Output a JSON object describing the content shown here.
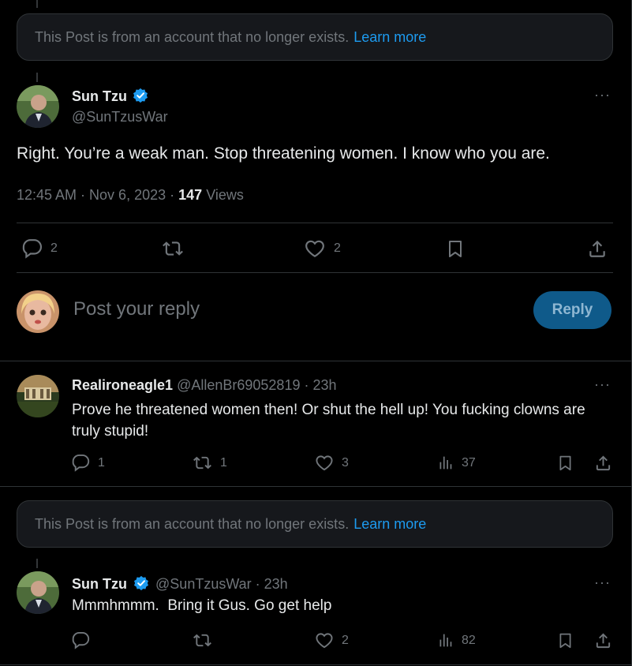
{
  "notice_top": {
    "text": "This Post is from an account that no longer exists.",
    "link": "Learn more"
  },
  "main_post": {
    "name": "Sun Tzu",
    "handle": "@SunTzusWar",
    "text": "Right. You’re a weak man. Stop threatening women. I know who you are.",
    "time": "12:45 AM · Nov 6, 2023 ·",
    "views_count": "147",
    "views_label": "Views",
    "replies": "2",
    "likes": "2"
  },
  "composer": {
    "placeholder": "Post your reply",
    "button": "Reply"
  },
  "reply1": {
    "name": "Realironeagle1",
    "handle": "@AllenBr69052819 · 23h",
    "text": "Prove he threatened women then! Or shut the hell up! You fucking clowns are truly stupid!",
    "replies": "1",
    "reposts": "1",
    "likes": "3",
    "views": "37"
  },
  "notice_mid": {
    "text": "This Post is from an account that no longer exists.",
    "link": "Learn more"
  },
  "reply2": {
    "name": "Sun Tzu",
    "handle": "@SunTzusWar · 23h",
    "text": "Mmmhmmm.  Bring it Gus. Go get help",
    "likes": "2",
    "views": "82"
  },
  "more_glyph": "···",
  "colors": {
    "accent": "#1d9bf0",
    "muted": "#71767b",
    "border": "#2f3336",
    "reply_button_bg": "#0f5a8a"
  },
  "icons": [
    "verified-badge-icon",
    "more-icon",
    "reply-icon",
    "repost-icon",
    "like-icon",
    "bookmark-icon",
    "share-icon",
    "views-icon"
  ]
}
